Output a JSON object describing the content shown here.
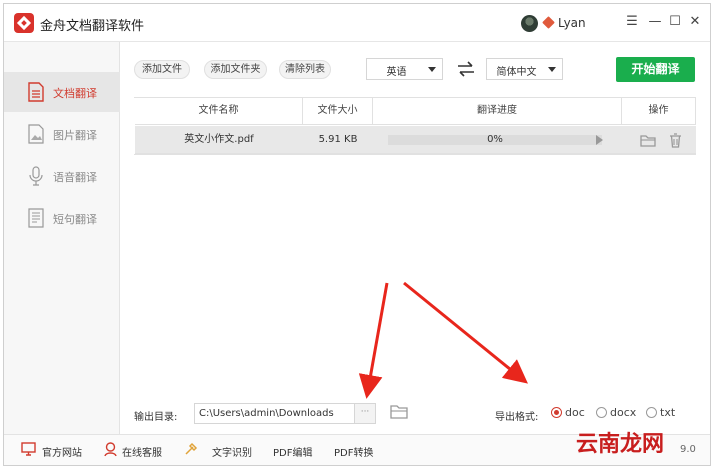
{
  "app": {
    "title": "金舟文档翻译软件",
    "username": "Lyan",
    "window_controls": {
      "menu": "☰",
      "minimize": "—",
      "maximize": "☐",
      "close": "✕"
    }
  },
  "sidebar": {
    "items": [
      {
        "label": "文档翻译",
        "icon": "document-icon",
        "active": true
      },
      {
        "label": "图片翻译",
        "icon": "image-icon",
        "active": false
      },
      {
        "label": "语音翻译",
        "icon": "microphone-icon",
        "active": false
      },
      {
        "label": "短句翻译",
        "icon": "text-icon",
        "active": false
      }
    ]
  },
  "toolbar": {
    "add_file": "添加文件",
    "add_folder": "添加文件夹",
    "clear_list": "清除列表",
    "source_lang": "英语",
    "target_lang": "简体中文",
    "start": "开始翻译"
  },
  "table": {
    "headers": [
      "文件名称",
      "文件大小",
      "翻译进度",
      "操作"
    ],
    "rows": [
      {
        "name": "英文小作文.pdf",
        "size": "5.91 KB",
        "progress_text": "0%",
        "progress": 0
      }
    ]
  },
  "output": {
    "label": "输出目录:",
    "path": "C:\\Users\\admin\\Downloads",
    "browse": "···",
    "format_label": "导出格式:",
    "formats": [
      {
        "label": "doc",
        "selected": true
      },
      {
        "label": "docx",
        "selected": false
      },
      {
        "label": "txt",
        "selected": false
      }
    ]
  },
  "footer": {
    "items": [
      "官方网站",
      "在线客服",
      "文字识别",
      "PDF编辑",
      "PDF转换"
    ],
    "version": "9.0"
  },
  "watermark": "云南龙网",
  "colors": {
    "accent": "#d13b2e",
    "green": "#1aae4d",
    "annotation": "#e8261c"
  }
}
